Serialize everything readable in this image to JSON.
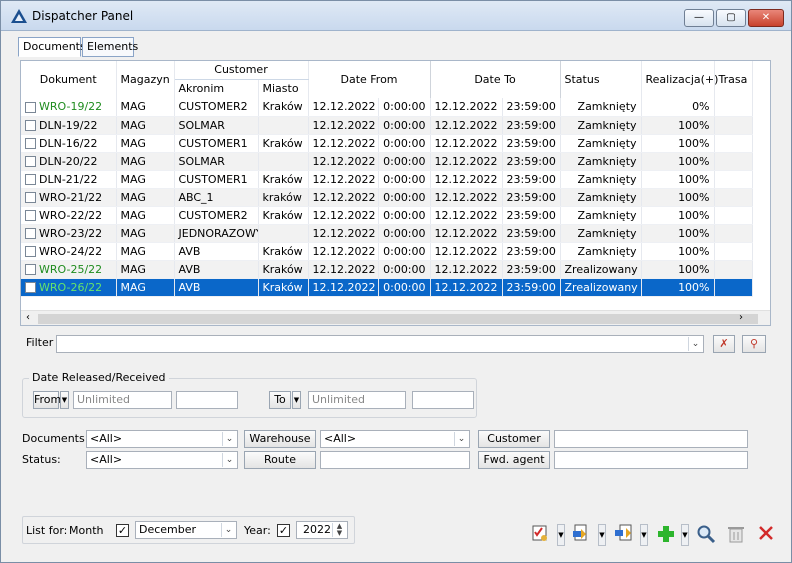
{
  "window": {
    "title": "Dispatcher Panel",
    "min_label": "—",
    "max_label": "▢",
    "close_label": "✕"
  },
  "tabs": [
    {
      "label": "Documents"
    },
    {
      "label": "Elements"
    }
  ],
  "grid": {
    "headers": {
      "dokument": "Dokument",
      "magazyn": "Magazyn",
      "customer": "Customer",
      "akronim": "Akronim",
      "miasto": "Miasto",
      "date_from": "Date From",
      "date_to": "Date To",
      "status": "Status",
      "realizacja": "Realizacja(+)",
      "trasa": "Trasa"
    },
    "rows": [
      {
        "doc": "WRO-19/22",
        "mag": "MAG",
        "akronim": "CUSTOMER2",
        "miasto": "Kraków",
        "from_date": "12.12.2022",
        "from_time": "0:00:00",
        "to_date": "12.12.2022",
        "to_time": "23:59:00",
        "status": "Zamknięty",
        "real": "0%"
      },
      {
        "doc": "DLN-19/22",
        "mag": "MAG",
        "akronim": "SOLMAR",
        "miasto": "",
        "from_date": "12.12.2022",
        "from_time": "0:00:00",
        "to_date": "12.12.2022",
        "to_time": "23:59:00",
        "status": "Zamknięty",
        "real": "100%"
      },
      {
        "doc": "DLN-16/22",
        "mag": "MAG",
        "akronim": "CUSTOMER1",
        "miasto": "Kraków",
        "from_date": "12.12.2022",
        "from_time": "0:00:00",
        "to_date": "12.12.2022",
        "to_time": "23:59:00",
        "status": "Zamknięty",
        "real": "100%"
      },
      {
        "doc": "DLN-20/22",
        "mag": "MAG",
        "akronim": "SOLMAR",
        "miasto": "",
        "from_date": "12.12.2022",
        "from_time": "0:00:00",
        "to_date": "12.12.2022",
        "to_time": "23:59:00",
        "status": "Zamknięty",
        "real": "100%"
      },
      {
        "doc": "DLN-21/22",
        "mag": "MAG",
        "akronim": "CUSTOMER1",
        "miasto": "Kraków",
        "from_date": "12.12.2022",
        "from_time": "0:00:00",
        "to_date": "12.12.2022",
        "to_time": "23:59:00",
        "status": "Zamknięty",
        "real": "100%"
      },
      {
        "doc": "WRO-21/22",
        "mag": "MAG",
        "akronim": "ABC_1",
        "miasto": "kraków",
        "from_date": "12.12.2022",
        "from_time": "0:00:00",
        "to_date": "12.12.2022",
        "to_time": "23:59:00",
        "status": "Zamknięty",
        "real": "100%"
      },
      {
        "doc": "WRO-22/22",
        "mag": "MAG",
        "akronim": "CUSTOMER2",
        "miasto": "Kraków",
        "from_date": "12.12.2022",
        "from_time": "0:00:00",
        "to_date": "12.12.2022",
        "to_time": "23:59:00",
        "status": "Zamknięty",
        "real": "100%"
      },
      {
        "doc": "WRO-23/22",
        "mag": "MAG",
        "akronim": "JEDNORAZOWY",
        "miasto": "",
        "from_date": "12.12.2022",
        "from_time": "0:00:00",
        "to_date": "12.12.2022",
        "to_time": "23:59:00",
        "status": "Zamknięty",
        "real": "100%"
      },
      {
        "doc": "WRO-24/22",
        "mag": "MAG",
        "akronim": "AVB",
        "miasto": "Kraków",
        "from_date": "12.12.2022",
        "from_time": "0:00:00",
        "to_date": "12.12.2022",
        "to_time": "23:59:00",
        "status": "Zamknięty",
        "real": "100%"
      },
      {
        "doc": "WRO-25/22",
        "mag": "MAG",
        "akronim": "AVB",
        "miasto": "Kraków",
        "from_date": "12.12.2022",
        "from_time": "0:00:00",
        "to_date": "12.12.2022",
        "to_time": "23:59:00",
        "status": "Zrealizowany",
        "real": "100%"
      },
      {
        "doc": "WRO-26/22",
        "mag": "MAG",
        "akronim": "AVB",
        "miasto": "Kraków",
        "from_date": "12.12.2022",
        "from_time": "0:00:00",
        "to_date": "12.12.2022",
        "to_time": "23:59:00",
        "status": "Zrealizowany",
        "real": "100%"
      }
    ]
  },
  "filter": {
    "label": "Filter",
    "value": ""
  },
  "date_group": {
    "title": "Date Released/Received",
    "from_label": "From",
    "from_value": "Unlimited",
    "from_time": "",
    "to_label": "To",
    "to_value": "Unlimited",
    "to_time": ""
  },
  "criteria": {
    "documents_label": "Documents:",
    "documents_value": "<All>",
    "warehouse_button": "Warehouse",
    "warehouse_value": "<All>",
    "customer_button": "Customer",
    "customer_value": "",
    "status_label": "Status:",
    "status_value": "<All>",
    "route_button": "Route",
    "route_value": "",
    "fwd_button": "Fwd. agent",
    "fwd_value": ""
  },
  "listfor": {
    "label": "List for:",
    "month_label": "Month",
    "month_checked": true,
    "month_value": "December",
    "year_label": "Year:",
    "year_checked": true,
    "year_value": "2022"
  },
  "colors": {
    "selection": "#0a67c9",
    "green_doc": "#1f8c1f",
    "add_green": "#2db52d",
    "delete_red": "#d22a2a"
  }
}
